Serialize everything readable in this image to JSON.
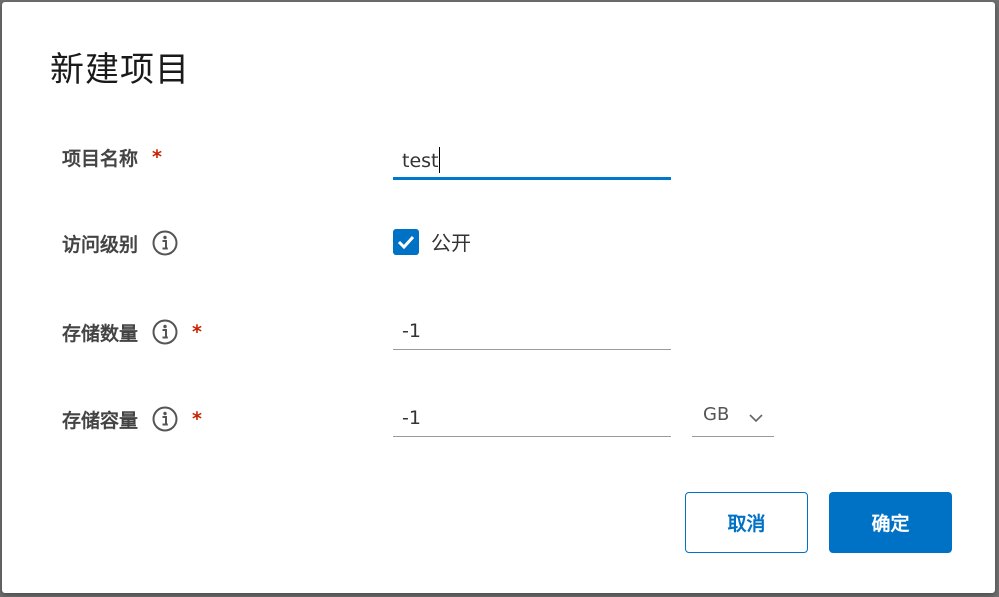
{
  "dialog": {
    "title": "新建项目"
  },
  "form": {
    "project_name": {
      "label": "项目名称",
      "required_mark": "*",
      "value": "test"
    },
    "access_level": {
      "label": "访问级别",
      "info_icon": "info-circle-icon",
      "checkbox_label": "公开",
      "checked": true
    },
    "storage_count": {
      "label": "存储数量",
      "info_icon": "info-circle-icon",
      "required_mark": "*",
      "value": "-1"
    },
    "storage_capacity": {
      "label": "存储容量",
      "info_icon": "info-circle-icon",
      "required_mark": "*",
      "value": "-1",
      "unit": "GB",
      "unit_icon": "chevron-down-icon"
    }
  },
  "buttons": {
    "cancel": "取消",
    "confirm": "确定"
  },
  "colors": {
    "accent": "#0072c6",
    "required": "#c92100",
    "focus_underline": "#0077cc"
  }
}
